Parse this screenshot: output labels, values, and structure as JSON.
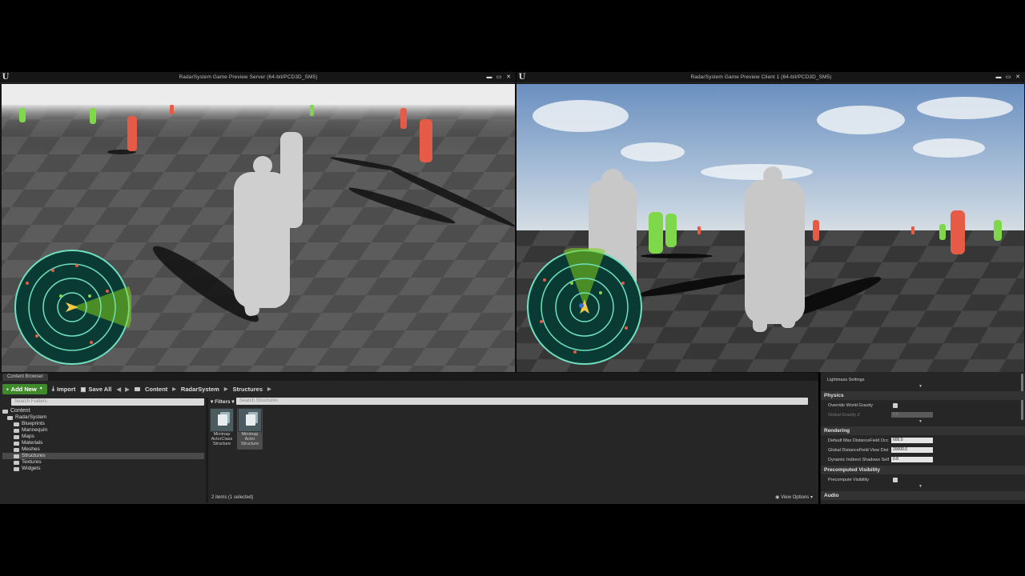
{
  "server_window": {
    "title": "RadarSystem Game Preview Server (64-bit/PCD3D_SM5)",
    "controls": [
      "▬",
      "▭",
      "✕"
    ]
  },
  "client_window": {
    "title": "RadarSystem Game Preview Client 1 (64-bit/PCD3D_SM5)",
    "controls": [
      "▬",
      "▭",
      "✕"
    ]
  },
  "content_browser": {
    "tab": "Content Browser",
    "toolbar": {
      "add_new": "Add New",
      "import": "Import",
      "save_all": "Save All"
    },
    "breadcrumb": [
      "Content",
      "RadarSystem",
      "Structures"
    ],
    "folder_search_placeholder": "Search Folders",
    "asset_search_placeholder": "Search Structures",
    "filters_label": "Filters",
    "tree": [
      {
        "label": "Content",
        "level": 0
      },
      {
        "label": "RadarSystem",
        "level": 1
      },
      {
        "label": "Blueprints",
        "level": 2
      },
      {
        "label": "Mannequin",
        "level": 2
      },
      {
        "label": "Maps",
        "level": 2
      },
      {
        "label": "Materials",
        "level": 2
      },
      {
        "label": "Meshes",
        "level": 2
      },
      {
        "label": "Structures",
        "level": 2,
        "selected": true
      },
      {
        "label": "Textures",
        "level": 2
      },
      {
        "label": "Widgets",
        "level": 2
      }
    ],
    "assets": [
      {
        "line1": "Minimap",
        "line2": "ActorClass",
        "line3": "Structure"
      },
      {
        "line1": "Minimap",
        "line2": "Actor",
        "line3": "Structure"
      }
    ],
    "status": "2 items (1 selected)",
    "view_options": "View Options"
  },
  "details": {
    "lightmass": "Lightmass Settings",
    "physics": {
      "header": "Physics",
      "override_world_gravity": "Override World Gravity",
      "global_gravity_z": "Global Gravity Z",
      "global_gravity_value": "0.0"
    },
    "rendering": {
      "header": "Rendering",
      "df_occ_label": "Default Max DistanceField Occ",
      "df_occ_value": "600.0",
      "df_view_label": "Global DistanceField View Dist",
      "df_view_value": "20000.0",
      "dyn_shadows_label": "Dynamic Indirect Shadows Self",
      "dyn_shadows_value": "0.8"
    },
    "precomputed": {
      "header": "Precomputed Visibility",
      "precompute_label": "Precompute Visibility"
    },
    "audio": "Audio"
  },
  "colors": {
    "radar_ring": "#6fe0c0",
    "radar_fill": "#0a3a34",
    "radar_cone": "#7fd21c",
    "enemy_red": "#e65b45",
    "ally_green": "#7ed84a",
    "add_new_green": "#3f8a2a"
  }
}
